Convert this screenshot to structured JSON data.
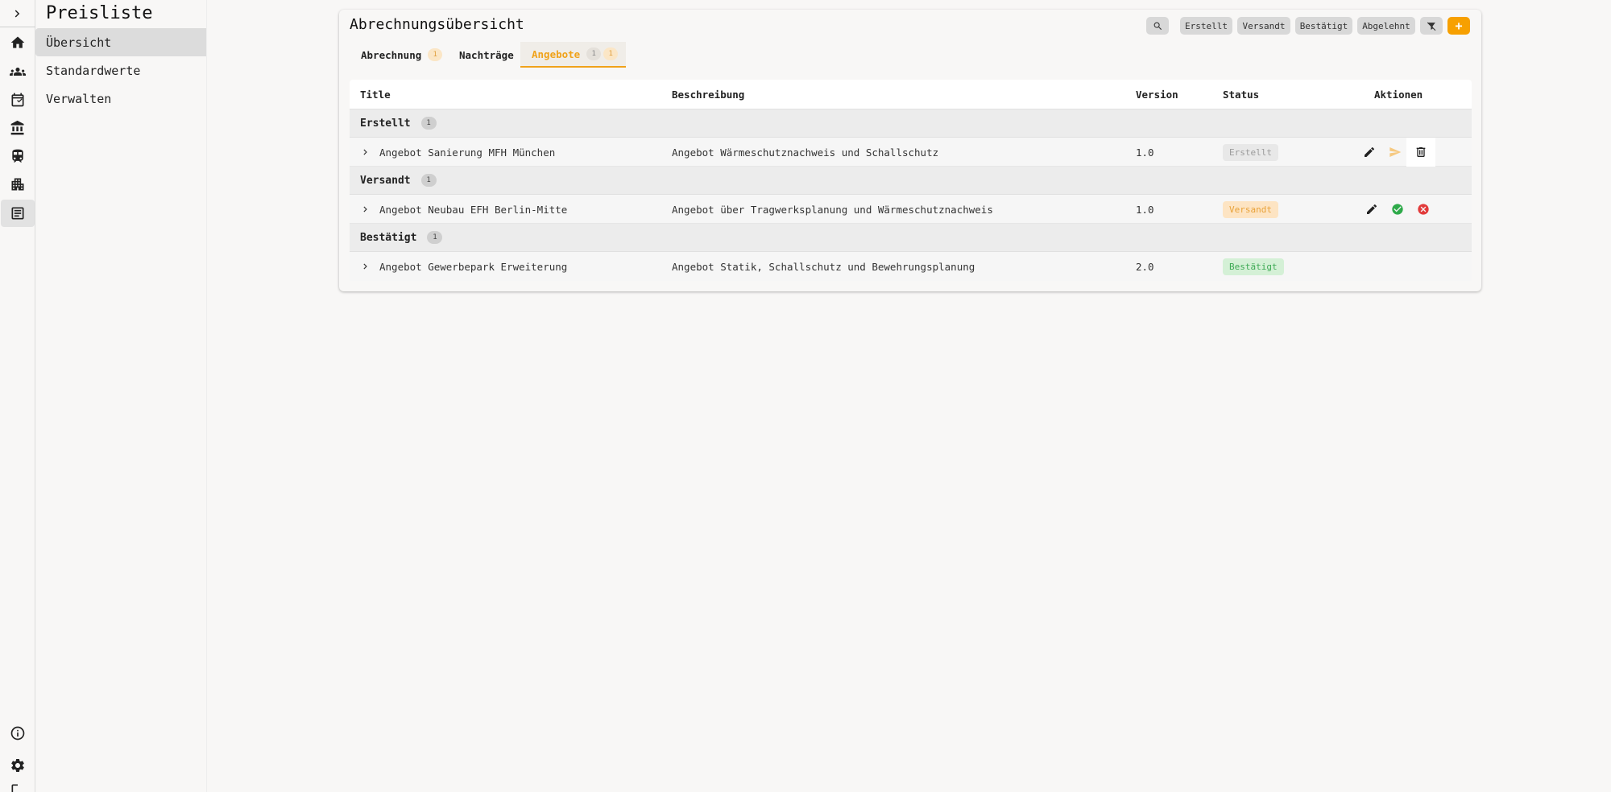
{
  "colors": {
    "accent": "#f7a000",
    "status_erstellt_bg": "#e8e8e8",
    "status_erstellt_fg": "#9b9b9b",
    "status_versandt_bg": "#fde4c3",
    "status_versandt_fg": "#e8a23a",
    "status_bestaetigt_bg": "#d4f0d6",
    "status_bestaetigt_fg": "#3faa55",
    "approve": "#2eaa4a",
    "reject": "#e23b3b"
  },
  "rail": {
    "icons": [
      "chevron-right-icon",
      "home-icon",
      "group-icon",
      "calendar-icon",
      "bank-icon",
      "train-icon",
      "buildings-icon",
      "receipt-icon",
      "info-icon",
      "gear-icon",
      "logout-icon"
    ]
  },
  "subnav": {
    "title": "Preisliste",
    "items": [
      {
        "label": "Übersicht",
        "active": true
      },
      {
        "label": "Standardwerte",
        "active": false
      },
      {
        "label": "Verwalten",
        "active": false
      }
    ]
  },
  "card": {
    "title": "Abrechnungsübersicht",
    "filters": [
      "Erstellt",
      "Versandt",
      "Bestätigt",
      "Abgelehnt"
    ],
    "add_label": "+"
  },
  "tabs": [
    {
      "label": "Abrechnung",
      "badge": "1"
    },
    {
      "label": "Nachträge"
    },
    {
      "label": "Angebote",
      "badge": "1",
      "badge2": "1",
      "active": true
    }
  ],
  "table": {
    "headers": {
      "title": "Title",
      "description": "Beschreibung",
      "version": "Version",
      "status": "Status",
      "actions": "Aktionen"
    },
    "groups": [
      {
        "name": "Erstellt",
        "count": "1",
        "rows": [
          {
            "title": "Angebot Sanierung MFH München",
            "description": "Angebot Wärmeschutznachweis und Schallschutz",
            "version": "1.0",
            "status": "Erstellt",
            "actions": [
              "edit-icon",
              "send-icon",
              "delete-icon"
            ]
          }
        ]
      },
      {
        "name": "Versandt",
        "count": "1",
        "rows": [
          {
            "title": "Angebot Neubau EFH Berlin-Mitte",
            "description": "Angebot über Tragwerksplanung und Wärmeschutznachweis",
            "version": "1.0",
            "status": "Versandt",
            "actions": [
              "edit-icon",
              "approve-icon",
              "reject-icon"
            ]
          }
        ]
      },
      {
        "name": "Bestätigt",
        "count": "1",
        "rows": [
          {
            "title": "Angebot Gewerbepark Erweiterung",
            "description": "Angebot Statik, Schallschutz und Bewehrungsplanung",
            "version": "2.0",
            "status": "Bestätigt",
            "actions": []
          }
        ]
      }
    ]
  }
}
